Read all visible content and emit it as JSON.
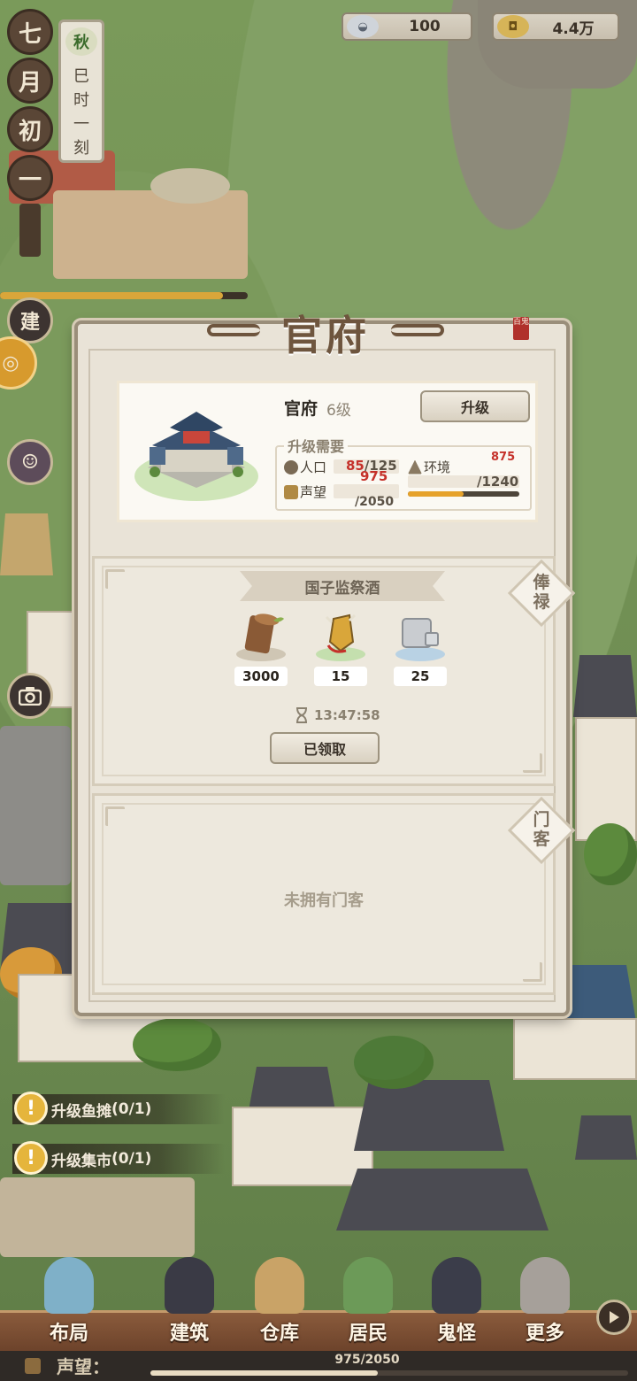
{
  "currency": {
    "silver": {
      "icon": "silver-ingot-icon",
      "value": "100"
    },
    "coins": {
      "icon": "copper-coin-icon",
      "value": "4.4万"
    }
  },
  "calendar": {
    "date_chars": [
      "七",
      "月",
      "初",
      "一"
    ],
    "season": "秋",
    "time": "巳时一刻",
    "day_progress": 0.9
  },
  "side_buttons": {
    "build": "建",
    "camera_icon": "camera-icon"
  },
  "modal": {
    "title": "官府",
    "seal": "百鬼",
    "building": {
      "name": "官府",
      "level": "6级",
      "upgrade_label": "升级",
      "requirements_title": "升级需要",
      "population": {
        "label": "人口",
        "current": "85",
        "required": "/125"
      },
      "environment": {
        "label": "环境",
        "current": "875",
        "required": "/1240",
        "progress": 0.5
      },
      "reputation": {
        "label": "声望",
        "current": "975",
        "required": "/2050"
      }
    },
    "salary": {
      "tag": "俸禄",
      "title": "国子监祭酒",
      "rewards": [
        {
          "icon": "wood-log-icon",
          "count": "3000"
        },
        {
          "icon": "scroll-token-icon",
          "count": "15"
        },
        {
          "icon": "stone-block-icon",
          "count": "25"
        }
      ],
      "timer": "13:47:58",
      "claimed_label": "已领取"
    },
    "retainers": {
      "tag": "门客",
      "empty_text": "未拥有门客"
    }
  },
  "quests": [
    {
      "prefix": "升级鱼摊",
      "progress": "(0/1)"
    },
    {
      "prefix": "升级集市",
      "progress": "(0/1)"
    }
  ],
  "nav": [
    {
      "label": "布局"
    },
    {
      "label": "建筑"
    },
    {
      "label": "仓库"
    },
    {
      "label": "居民"
    },
    {
      "label": "鬼怪"
    },
    {
      "label": "更多"
    }
  ],
  "reputation_bar": {
    "label": "声望：",
    "value": "975/2050",
    "progress": 0.476
  },
  "colors": {
    "accent_gold": "#e6a22b",
    "warning_red": "#c5312a",
    "panel_bg": "#e9e3d7"
  }
}
